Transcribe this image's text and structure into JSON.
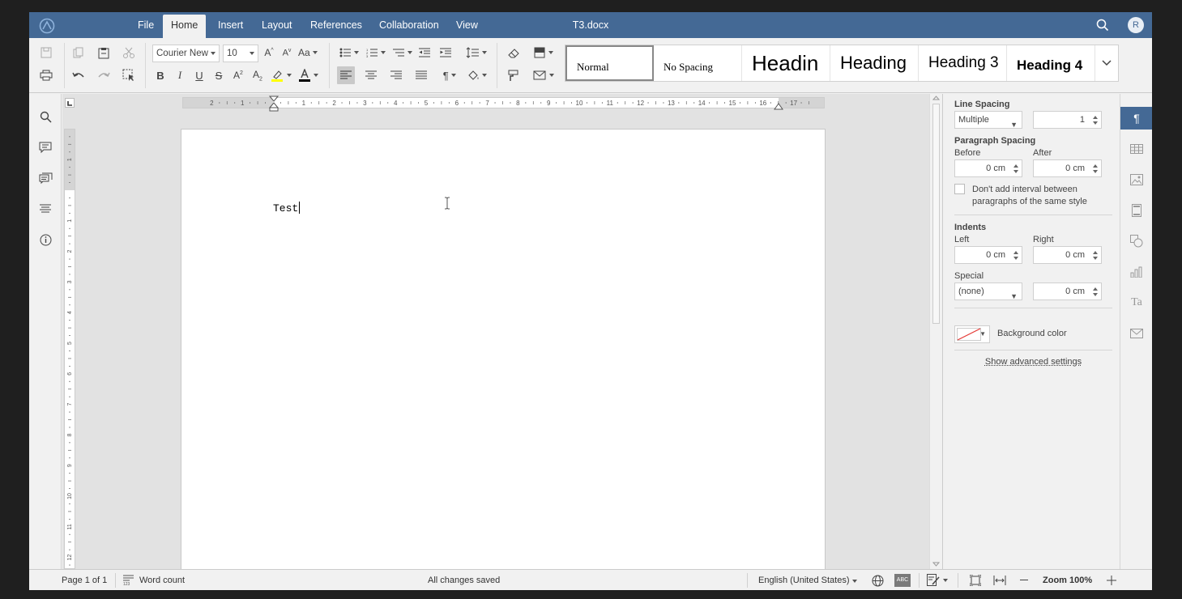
{
  "app": {
    "document_title": "T3.docx",
    "user_initial": "R"
  },
  "menu": {
    "tabs": [
      "File",
      "Home",
      "Insert",
      "Layout",
      "References",
      "Collaboration",
      "View"
    ],
    "active": "Home"
  },
  "ribbon": {
    "font_name": "Courier New",
    "font_size": "10",
    "styles": [
      "Normal",
      "No Spacing",
      "Headin",
      "Heading",
      "Heading 3",
      "Heading 4"
    ],
    "selected_style": "Normal"
  },
  "document": {
    "text": "Test"
  },
  "ruler": {
    "h_labels": [
      "2",
      "1",
      "1",
      "2",
      "3",
      "4",
      "5",
      "6",
      "7",
      "8",
      "9",
      "10",
      "11",
      "12",
      "13",
      "14",
      "15",
      "16",
      "17"
    ],
    "v_labels": [
      "1",
      "1",
      "2",
      "3",
      "4",
      "5",
      "6",
      "7",
      "8",
      "9",
      "10",
      "11",
      "12"
    ]
  },
  "paragraph_panel": {
    "line_spacing_title": "Line Spacing",
    "line_spacing_mode": "Multiple",
    "line_spacing_value": "1",
    "paragraph_spacing_title": "Paragraph Spacing",
    "before_label": "Before",
    "before_value": "0 cm",
    "after_label": "After",
    "after_value": "0 cm",
    "no_interval_label": "Don't add interval between paragraphs of the same style",
    "no_interval_checked": false,
    "indents_title": "Indents",
    "left_label": "Left",
    "left_value": "0 cm",
    "right_label": "Right",
    "right_value": "0 cm",
    "special_label": "Special",
    "special_mode": "(none)",
    "special_value": "0 cm",
    "background_color_label": "Background color",
    "advanced_link": "Show advanced settings"
  },
  "statusbar": {
    "page_info": "Page 1 of 1",
    "word_count": "Word count",
    "save_status": "All changes saved",
    "language": "English (United States)",
    "zoom": "Zoom 100%"
  },
  "colors": {
    "brand": "#446995",
    "highlight": "#ffff00",
    "font_color": "#000000"
  }
}
